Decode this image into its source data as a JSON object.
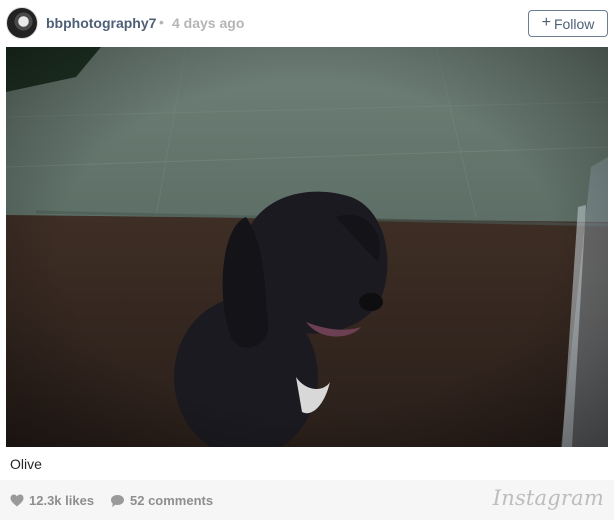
{
  "post": {
    "username": "bbphotography7",
    "separator": "•",
    "time_ago": "4 days ago",
    "follow_label": "Follow",
    "follow_icon": "plus-icon",
    "caption": "Olive"
  },
  "stats": {
    "likes": "12.3k likes",
    "likes_icon": "heart-icon",
    "comments": "52 comments",
    "comments_icon": "speech-bubble-icon"
  },
  "brand": "Instagram",
  "colors": {
    "username": "#4e6078",
    "muted": "#b5b5b5",
    "footer_bg": "#f6f6f6"
  }
}
